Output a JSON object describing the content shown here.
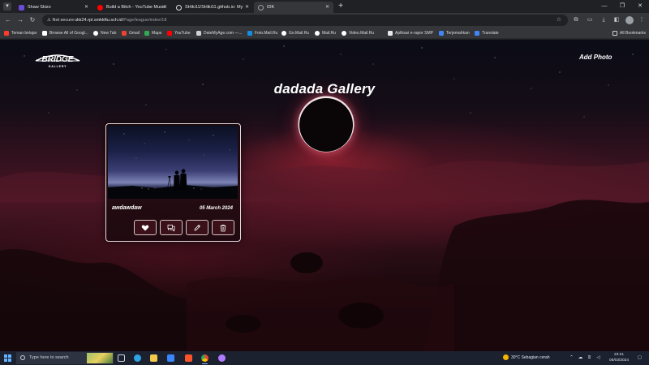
{
  "browser": {
    "tabs": [
      {
        "title": "Shaw Skizo",
        "favicon_color": "#6c4bd6",
        "active": false
      },
      {
        "title": "Build a Bitch - YouTube Music",
        "favicon_color": "#ff0000",
        "active": false
      },
      {
        "title": "SHiki11/SHiki11.github.io: My",
        "favicon_color": "#ffffff",
        "active": false
      },
      {
        "title": "IDK",
        "favicon_color": "#9aa0a6",
        "active": true
      }
    ],
    "new_tab_label": "+",
    "address": {
      "security_label": "Not secure",
      "host": "ukk24.rpl.smkkftu.sch.id",
      "path": "/Page/league/index/18"
    },
    "bookmarks": [
      {
        "label": "Teman belajar",
        "color": "#ff3b30"
      },
      {
        "label": "Browse All of Googl...",
        "color": "#ffffff"
      },
      {
        "label": "New Tab",
        "color": "#ffffff"
      },
      {
        "label": "Gmail",
        "color": "#ea4335"
      },
      {
        "label": "Maps",
        "color": "#34a853"
      },
      {
        "label": "YouTube",
        "color": "#ff0000"
      },
      {
        "label": "DateMyAge.com —...",
        "color": "#cfcfcf"
      },
      {
        "label": "Foto.Mail.Ru",
        "color": "#168de2"
      },
      {
        "label": "Go.Mail.Ru",
        "color": "#ffffff"
      },
      {
        "label": "Mail.Ru",
        "color": "#ffffff"
      },
      {
        "label": "Video.Mail.Ru",
        "color": "#ffffff"
      },
      {
        "label": "Aplikasi e-rapor SMP",
        "color": "#e8e8e8"
      },
      {
        "label": "Terjemahkan",
        "color": "#4285f4"
      },
      {
        "label": "Translate",
        "color": "#4285f4"
      }
    ],
    "all_bookmarks_label": "All Bookmarks"
  },
  "page": {
    "logo_text": "BRIDGE",
    "logo_sub": "GALLERY",
    "add_photo_label": "Add Photo",
    "gallery_title": "dadada Gallery",
    "cards": [
      {
        "caption": "awdawdaw",
        "date": "05 March 2024",
        "actions": [
          "heart-icon",
          "comment-icon",
          "pencil-icon",
          "trash-icon"
        ]
      }
    ]
  },
  "taskbar": {
    "search_placeholder": "Type here to search",
    "apps": [
      {
        "name": "task-view",
        "color": "#cfd3da",
        "running": false
      },
      {
        "name": "edge",
        "color": "#2ea3e6",
        "running": false
      },
      {
        "name": "file-explorer",
        "color": "#f2c94c",
        "running": false
      },
      {
        "name": "mail",
        "color": "#3a86ff",
        "running": false
      },
      {
        "name": "brave",
        "color": "#fb542b",
        "running": false
      },
      {
        "name": "chrome",
        "color": "#fbbc05",
        "running": true
      },
      {
        "name": "opera-gx",
        "color": "#b07cff",
        "running": false
      }
    ],
    "weather_temp": "30°C",
    "weather_text": "Sebagian cerah",
    "time": "23:21",
    "date": "06/03/2024"
  }
}
